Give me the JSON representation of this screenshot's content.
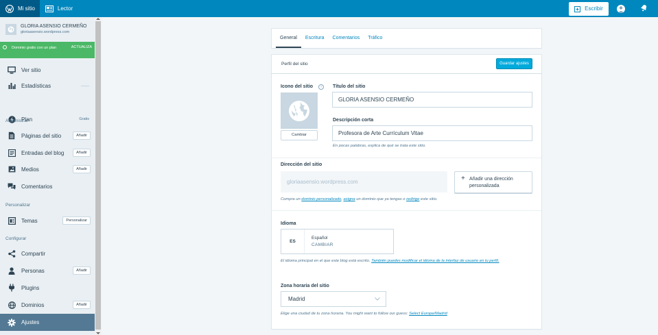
{
  "topbar": {
    "my_site": "Mi sitio",
    "reader": "Lector",
    "write": "Escribir"
  },
  "sidebar": {
    "site_name": "GLORIA ASENSIO CERMEÑO",
    "site_url": "gloriaasensio.wordpress.com",
    "promo_text": "Dominio gratis con un plan",
    "promo_cta": "ACTUALIZA",
    "items": [
      {
        "label": "Ver sitio"
      },
      {
        "label": "Estadísticas"
      },
      {
        "label": "Plan",
        "extra": "Gratis"
      },
      {
        "label": "Páginas del sitio",
        "badge": "Añadir"
      },
      {
        "label": "Entradas del blog",
        "badge": "Añadir"
      },
      {
        "label": "Medios",
        "badge": "Añadir"
      },
      {
        "label": "Comentarios"
      },
      {
        "label": "Temas",
        "badge": "Personalizar"
      },
      {
        "label": "Compartir"
      },
      {
        "label": "Personas",
        "badge": "Añadir"
      },
      {
        "label": "Plugins"
      },
      {
        "label": "Dominios",
        "badge": "Añadir"
      },
      {
        "label": "Ajustes"
      }
    ],
    "sections": {
      "administrar": "Administrar",
      "personalizar": "Personalizar",
      "configurar": "Configurar"
    }
  },
  "tabs": [
    "General",
    "Escritura",
    "Comentarios",
    "Tráfico"
  ],
  "profile": {
    "title": "Perfil del sitio",
    "save": "Guardar ajustes",
    "icon_label": "Icono del sitio",
    "icon_info": "i",
    "change": "Cambiar",
    "title_label": "Título del sitio",
    "title_value": "GLORIA ASENSIO CERMEÑO",
    "desc_label": "Descripción corta",
    "desc_value": "Profesora de Arte Currículum Vitae",
    "desc_hint": "En pocas palabras, explica de qué se trata este sitio.",
    "address_label": "Dirección del sitio",
    "address_value": "gloriaasensio.wordpress.com",
    "add_address": "Añadir una dirección personalizada",
    "add_plus": "+",
    "address_hint": {
      "t1": "Compra un ",
      "l1": "dominio personalizado",
      "t2": ", ",
      "l2": "asigna",
      "t3": " un dominio que ya tengas o ",
      "l3": "redirige",
      "t4": " este sitio."
    },
    "language_label": "Idioma",
    "language_code": "ES",
    "language_name": "Español",
    "language_change": "CAMBIAR",
    "language_hint": {
      "t1": "El idioma principal en el que este blog está escrito. ",
      "l1": "También puedes modificar el idioma de la interfaz de usuario en tu perfil."
    },
    "timezone_label": "Zona horaria del sitio",
    "timezone_value": "Madrid",
    "timezone_hint": {
      "t1": "Elige una ciudad de tu zona horaria. You might want to follow our guess: ",
      "l1": "Select Europe/Madrid"
    }
  },
  "colors": {
    "topbar": "#0087be",
    "topbar_active": "#005a87",
    "promo": "#4ab866",
    "active_nav": "#537994",
    "primary_button": "#00aadc"
  }
}
